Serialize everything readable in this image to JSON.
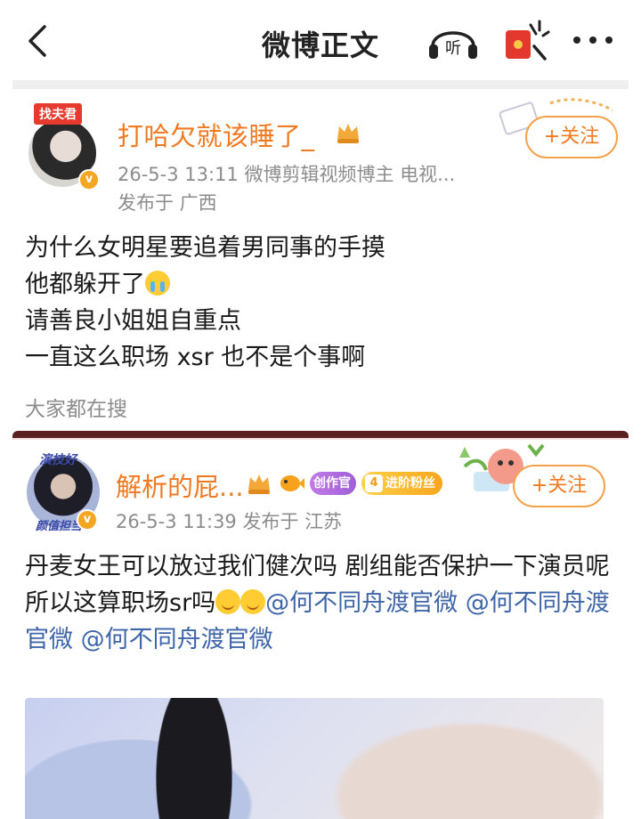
{
  "header": {
    "title": "微博正文",
    "listen_label": "听"
  },
  "post1": {
    "avatar_tag": "找夫君",
    "username": "打哈欠就该睡了_",
    "meta_line": "26-5-3 13:11  微博剪辑视频博主 电视...",
    "location": "发布于 广西",
    "follow_label": "+关注",
    "lines": [
      "为什么女明星要追着男同事的手摸",
      "他都躲开了",
      "请善良小姐姐自重点",
      "一直这么职场 xsr 也不是个事啊"
    ],
    "everyone_searching": "大家都在搜"
  },
  "post2": {
    "avatar_tag_top": "演技好",
    "avatar_tag_bottom": "颜值担当",
    "username": "解析的屁...",
    "badge_creator": "创作官",
    "badge_fan_level": "4",
    "badge_fan": "进阶粉丝",
    "follow_label": "+关注",
    "meta_line": "26-5-3 11:39  发布于 江苏",
    "text_part1": "丹麦女王可以放过我们健次吗 剧组能否保护一下演员呢  所以这算职场sr吗",
    "mention1": "@何不同舟渡官微",
    "mention2": "@何不同舟渡官微",
    "mention3": "@何不同舟渡官微"
  },
  "colors": {
    "username": "#f07a22",
    "follow_border": "#f5a14a",
    "meta": "#8c8c8c",
    "mention": "#3f66a8"
  }
}
